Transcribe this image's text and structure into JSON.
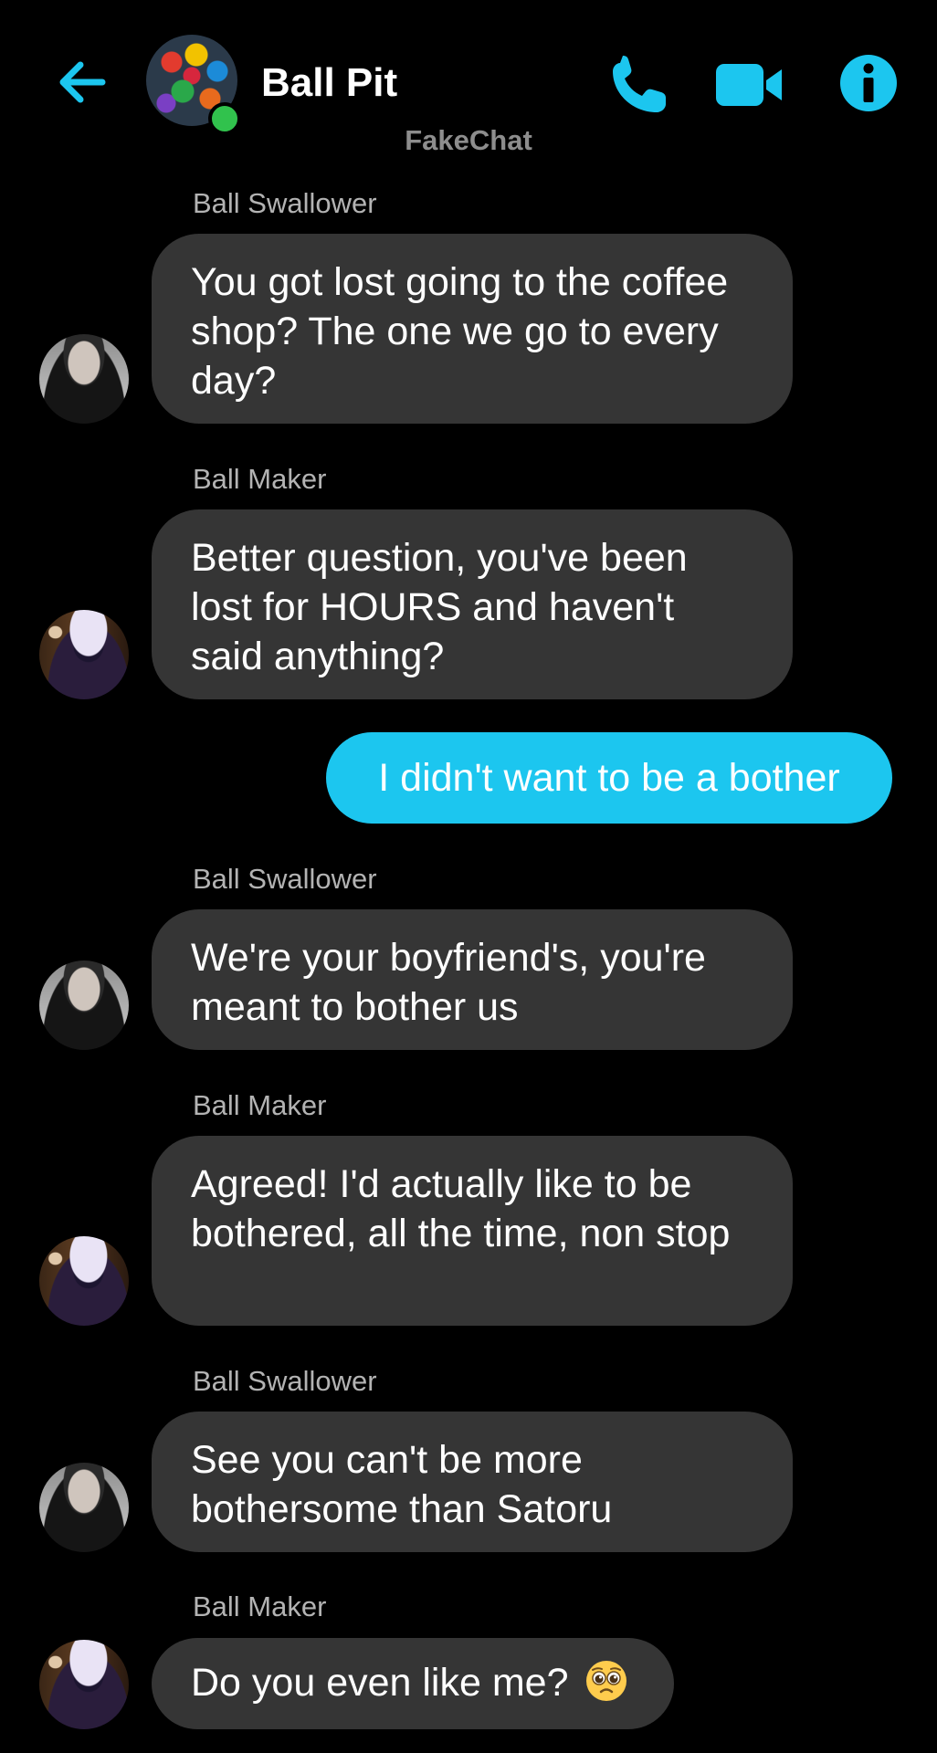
{
  "header": {
    "title": "Ball Pit",
    "subtitle": "FakeChat",
    "accent_color": "#1cc6ef",
    "icons": [
      "back-arrow-icon",
      "phone-icon",
      "video-camera-icon",
      "info-icon"
    ]
  },
  "messages": [
    {
      "sender": "Ball Swallower",
      "text": "You got lost going to the coffee shop? The one we go to every day?",
      "own": false
    },
    {
      "sender": "Ball Maker",
      "text": "Better question, you've been lost for HOURS and haven't said anything?",
      "own": false
    },
    {
      "sender": "",
      "text": "I didn't want to be a bother",
      "own": true
    },
    {
      "sender": "Ball Swallower",
      "text": "We're your boyfriend's, you're meant to bother us",
      "own": false
    },
    {
      "sender": "Ball Maker",
      "text": "Agreed!  I'd actually like to be bothered, all the time, non stop",
      "own": false
    },
    {
      "sender": "Ball Swallower",
      "text": "See you can't be more bothersome than Satoru",
      "own": false
    },
    {
      "sender": "Ball Maker",
      "text": "Do you even like me?",
      "own": false,
      "emoji": "pleading-face-emoji"
    }
  ]
}
